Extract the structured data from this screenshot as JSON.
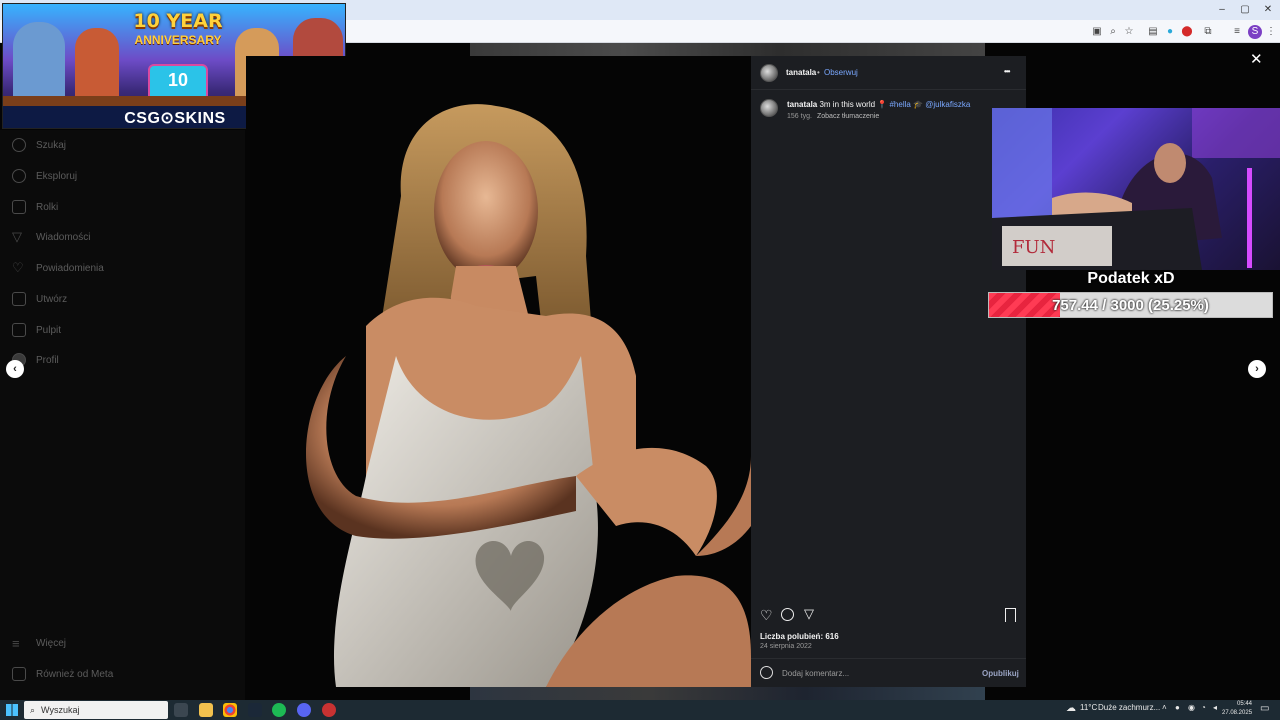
{
  "browser": {
    "window_controls": {
      "minimize": "–",
      "maximize": "▢",
      "close": "✕"
    }
  },
  "ad": {
    "anniversary_number": "10",
    "anniversary_word": "YEAR",
    "anniversary_sub": "ANNIVERSARY",
    "cake_number": "10",
    "brand": "CSG⊙SKINS"
  },
  "sidebar": {
    "items": [
      {
        "label": "Szukaj",
        "icon": "search-icon"
      },
      {
        "label": "Eksploruj",
        "icon": "compass-icon"
      },
      {
        "label": "Rolki",
        "icon": "reels-icon"
      },
      {
        "label": "Wiadomości",
        "icon": "send-icon"
      },
      {
        "label": "Powiadomienia",
        "icon": "heart-icon"
      },
      {
        "label": "Utwórz",
        "icon": "plus-icon"
      },
      {
        "label": "Pulpit",
        "icon": "dashboard-icon"
      },
      {
        "label": "Profil",
        "icon": "profile-icon"
      }
    ],
    "bottom": [
      {
        "label": "Więcej",
        "icon": "menu-icon"
      },
      {
        "label": "Również od Meta",
        "icon": "meta-icon"
      }
    ]
  },
  "post": {
    "username": "tanatala",
    "separator": "•",
    "follow": "Obserwuj",
    "more": "•••",
    "caption_user": "tanatala",
    "caption_text": "3m in this world 📍",
    "caption_hashtag": "#hella",
    "caption_emoji": "🎓",
    "caption_mention": "@julkafiszka",
    "caption_age": "156 tyg.",
    "see_translation": "Zobacz tłumaczenie",
    "likes": "Liczba polubień: 616",
    "date": "24 sierpnia 2022",
    "comment_placeholder": "Dodaj komentarz...",
    "publish": "Opublikuj"
  },
  "overlay": {
    "title": "Podatek xD",
    "goal_text": "757.44 / 3000 (25.25%)",
    "goal_progress": 0.2525
  },
  "close": "✕",
  "arrows": {
    "prev": "‹",
    "next": "›"
  },
  "taskbar": {
    "search": "Wyszukaj",
    "weather": "11°C",
    "weather_desc": "Duże zachmurz...",
    "time": "05:44",
    "date": "27.08.2025"
  },
  "colors": {
    "accent_blue": "#7aa8ff",
    "goal_red": "#ff3b54",
    "panel_bg": "#1c1e22"
  }
}
